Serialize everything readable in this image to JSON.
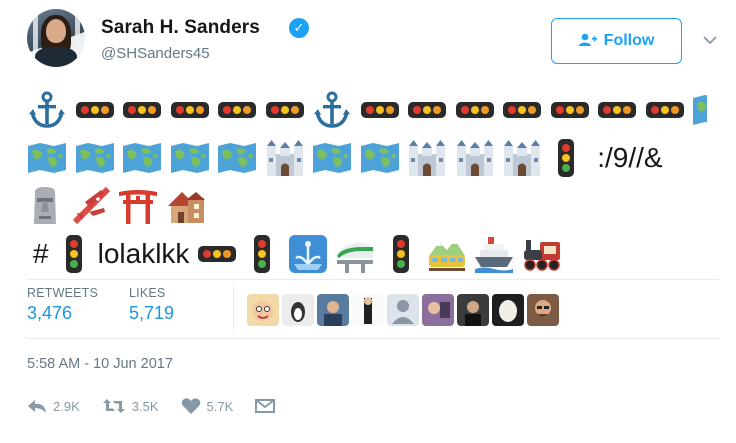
{
  "user": {
    "name": "Sarah H. Sanders",
    "handle": "@SHSanders45",
    "verified_glyph": "✓"
  },
  "follow": {
    "label": "Follow",
    "icon": "add-user-icon"
  },
  "tweet": {
    "text_fragments": {
      "line2_text": ":/9//&",
      "line4_hash": "#",
      "line4_text": "lolaklkk"
    }
  },
  "stats": {
    "retweets_label": "RETWEETS",
    "retweets_value": "3,476",
    "likes_label": "LIKES",
    "likes_value": "5,719"
  },
  "timestamp": "5:58 AM - 10 Jun 2017",
  "actions": {
    "reply_count": "2.9K",
    "retweet_count": "3.5K",
    "like_count": "5.7K"
  },
  "colors": {
    "accent": "#1da1f2",
    "link": "#1b95e0",
    "muted": "#657786"
  }
}
